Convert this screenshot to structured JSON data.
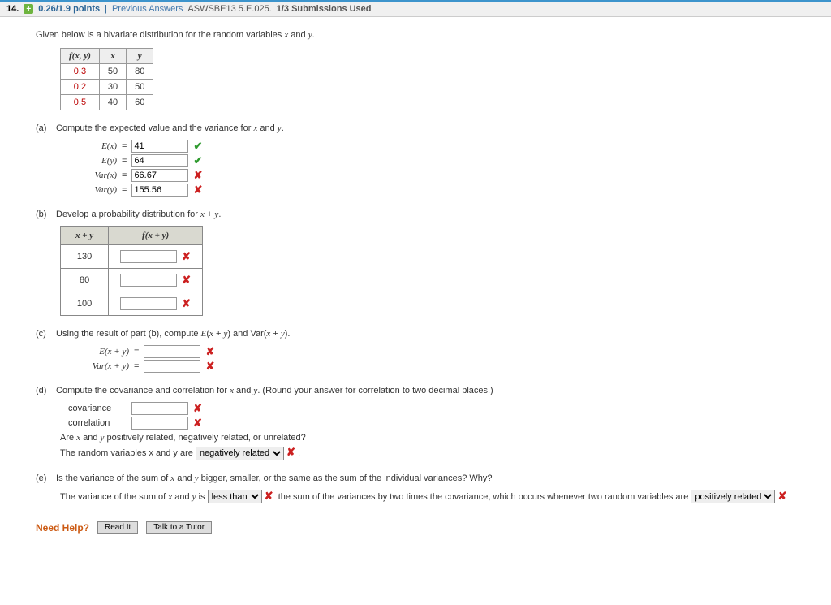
{
  "header": {
    "qnum": "14.",
    "plus": "+",
    "points": "0.26/1.9 points",
    "sep": "|",
    "prev": "Previous Answers",
    "ref": "ASWSBE13 5.E.025.",
    "subm": "1/3 Submissions Used"
  },
  "intro": "Given below is a bivariate distribution for the random variables x and y.",
  "bivar": {
    "h1": "f(x, y)",
    "h2": "x",
    "h3": "y",
    "rows": [
      {
        "f": "0.3",
        "x": "50",
        "y": "80"
      },
      {
        "f": "0.2",
        "x": "30",
        "y": "50"
      },
      {
        "f": "0.5",
        "x": "40",
        "y": "60"
      }
    ]
  },
  "parts": {
    "a": {
      "label": "(a)",
      "text": "Compute the expected value and the variance for x and y.",
      "rows": [
        {
          "lbl": "E(x)",
          "eq": "=",
          "val": "41",
          "mark": "ok"
        },
        {
          "lbl": "E(y)",
          "eq": "=",
          "val": "64",
          "mark": "ok"
        },
        {
          "lbl": "Var(x)",
          "eq": "=",
          "val": "66.67",
          "mark": "bad"
        },
        {
          "lbl": "Var(y)",
          "eq": "=",
          "val": "155.56",
          "mark": "bad"
        }
      ]
    },
    "b": {
      "label": "(b)",
      "text": "Develop a probability distribution for x + y.",
      "th1": "x + y",
      "th2": "f(x + y)",
      "rows": [
        {
          "xy": "130",
          "mark": "bad"
        },
        {
          "xy": "80",
          "mark": "bad"
        },
        {
          "xy": "100",
          "mark": "bad"
        }
      ]
    },
    "c": {
      "label": "(c)",
      "text": "Using the result of part (b), compute E(x + y) and Var(x + y).",
      "rows": [
        {
          "lbl": "E(x + y)",
          "eq": "=",
          "mark": "bad"
        },
        {
          "lbl": "Var(x + y)",
          "eq": "=",
          "mark": "bad"
        }
      ]
    },
    "d": {
      "label": "(d)",
      "text": "Compute the covariance and correlation for x and y. (Round your answer for correlation to two decimal places.)",
      "rows": [
        {
          "lbl": "covariance",
          "mark": "bad"
        },
        {
          "lbl": "correlation",
          "mark": "bad"
        }
      ],
      "q2": "Are x and y positively related, negatively related, or unrelated?",
      "ans2_pre": "The random variables x and y are",
      "sel2": "negatively related",
      "ans2_post": ".",
      "mark2": "bad"
    },
    "e": {
      "label": "(e)",
      "text": "Is the variance of the sum of x and y bigger, smaller, or the same as the sum of the individual variances? Why?",
      "pre": "The variance of the sum of x and y is",
      "sel1": "less than",
      "mark1": "bad",
      "mid": "the sum of the variances by two times the covariance, which occurs whenever two random variables are",
      "sel2": "positively related",
      "mark2": "bad"
    }
  },
  "marks": {
    "ok": "✔",
    "bad": "✘"
  },
  "help": {
    "label": "Need Help?",
    "read": "Read It",
    "tutor": "Talk to a Tutor"
  }
}
